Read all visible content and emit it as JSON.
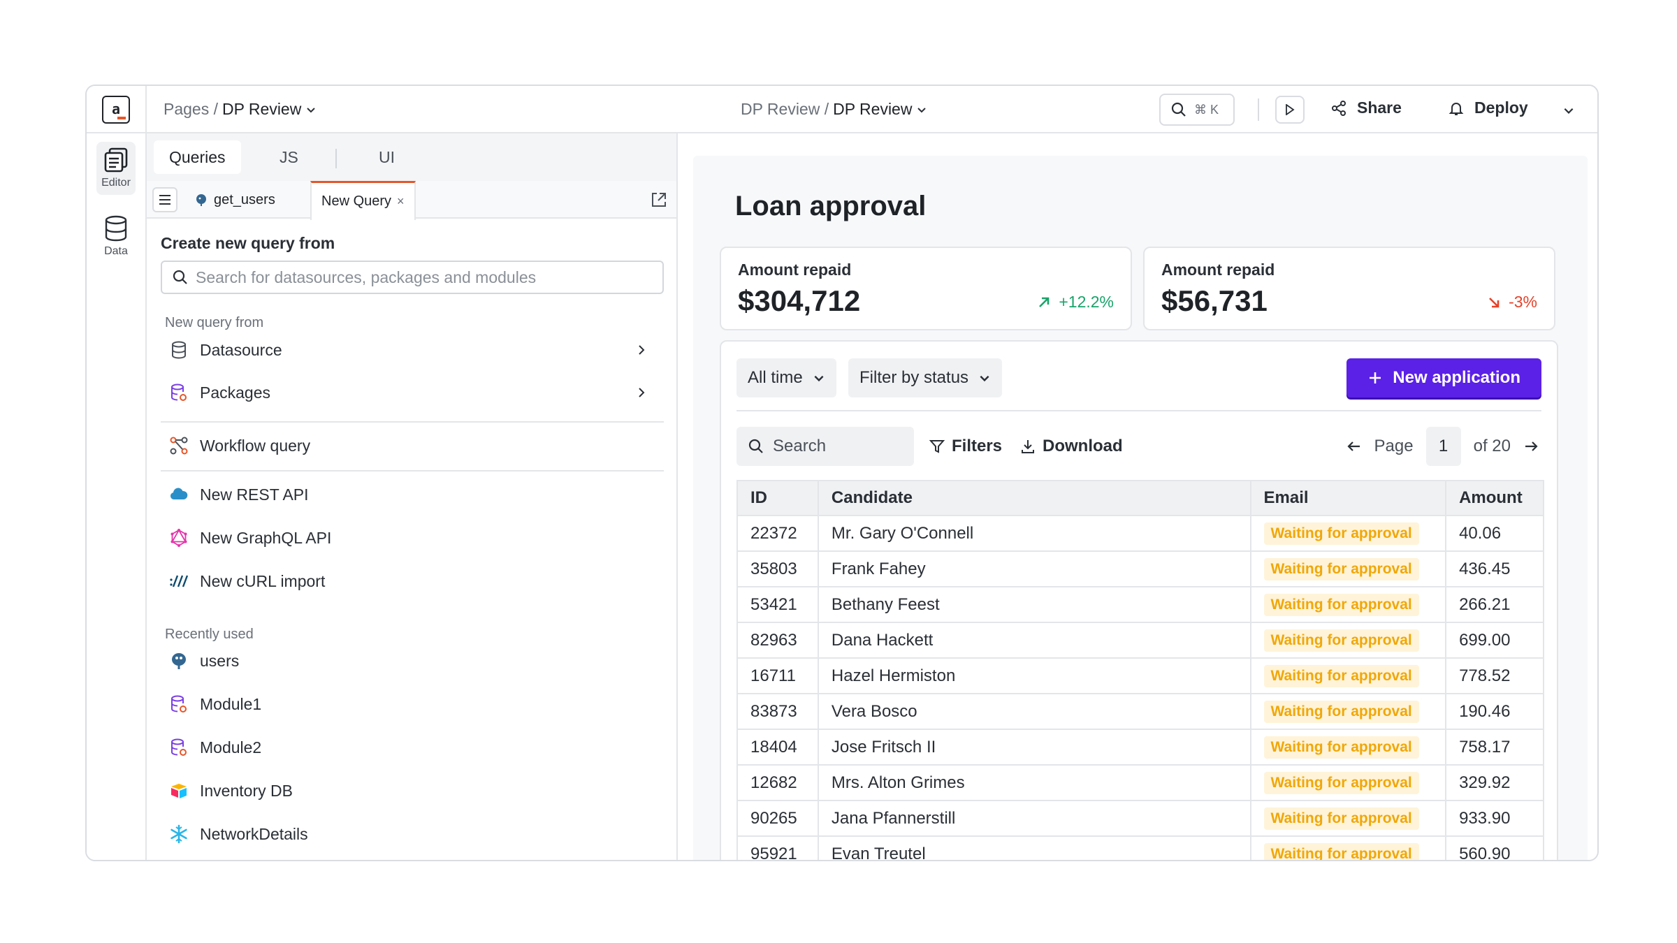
{
  "header": {
    "breadcrumb_root": "Pages /",
    "breadcrumb_page": "DP Review",
    "center_root": "DP Review /",
    "center_page": "DP Review",
    "search_shortcut": "⌘ K",
    "share_label": "Share",
    "deploy_label": "Deploy"
  },
  "rail": {
    "editor_label": "Editor",
    "data_label": "Data"
  },
  "panel": {
    "tabs": [
      "Queries",
      "JS",
      "UI"
    ],
    "file_tabs": [
      "get_users",
      "New Query"
    ],
    "close_glyph": "×",
    "title": "Create new query from",
    "search_placeholder": "Search for datasources, packages and modules",
    "new_from_label": "New query from",
    "items": {
      "datasource": "Datasource",
      "packages": "Packages",
      "workflow": "Workflow query",
      "rest": "New REST API",
      "graphql": "New GraphQL API",
      "curl": "New cURL import"
    },
    "recent_label": "Recently used",
    "recent": [
      "users",
      "Module1",
      "Module2",
      "Inventory DB",
      "NetworkDetails"
    ]
  },
  "app": {
    "title": "Loan approval",
    "stats": [
      {
        "label": "Amount repaid",
        "value": "$304,712",
        "change": "+12.2%",
        "color": "#1aa36b"
      },
      {
        "label": "Amount repaid",
        "value": "$56,731",
        "change": "-3%",
        "color": "#e5422a"
      }
    ],
    "time_filter": "All time",
    "status_filter": "Filter by status",
    "new_button": "New application",
    "search_label": "Search",
    "filters_label": "Filters",
    "download_label": "Download",
    "page_label": "Page",
    "page_number": "1",
    "page_total": "of 20",
    "accent": "#5b21e6",
    "table": {
      "columns": [
        "ID",
        "Candidate",
        "Email",
        "Amount"
      ],
      "rows": [
        [
          "22372",
          "Mr. Gary O'Connell",
          "Waiting for approval",
          "40.06"
        ],
        [
          "35803",
          "Frank Fahey",
          "Waiting for approval",
          "436.45"
        ],
        [
          "53421",
          "Bethany Feest",
          "Waiting for approval",
          "266.21"
        ],
        [
          "82963",
          "Dana Hackett",
          "Waiting for approval",
          "699.00"
        ],
        [
          "16711",
          "Hazel Hermiston",
          "Waiting for approval",
          "778.52"
        ],
        [
          "83873",
          "Vera Bosco",
          "Waiting for approval",
          "190.46"
        ],
        [
          "18404",
          "Jose Fritsch II",
          "Waiting for approval",
          "758.17"
        ],
        [
          "12682",
          "Mrs. Alton Grimes",
          "Waiting for approval",
          "329.92"
        ],
        [
          "90265",
          "Jana Pfannerstill",
          "Waiting for approval",
          "933.90"
        ],
        [
          "95921",
          "Evan Treutel",
          "Waiting for approval",
          "560.90"
        ]
      ]
    }
  }
}
